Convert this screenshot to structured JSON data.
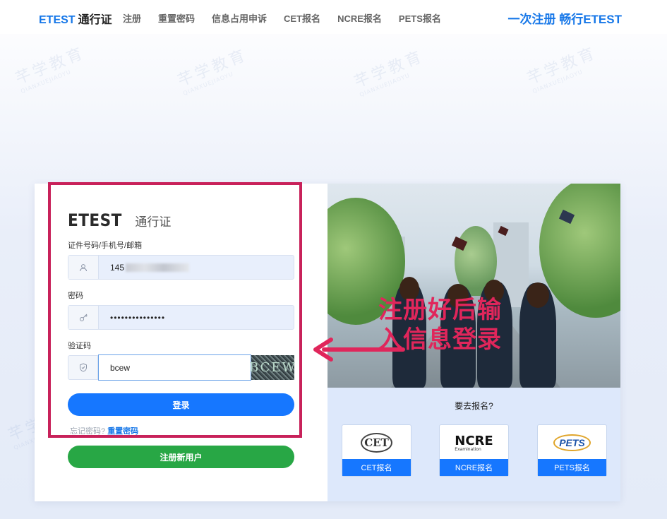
{
  "nav": {
    "brand": "ETEST",
    "brand_sub": "通行证",
    "links": [
      "注册",
      "重置密码",
      "信息占用申诉",
      "CET报名",
      "NCRE报名",
      "PETS报名"
    ],
    "slogan": "一次注册 畅行ETEST"
  },
  "watermark": {
    "text": "芊学教育",
    "sub": "QIANXUEJIAOYU"
  },
  "login": {
    "logo_big": "ETEST",
    "logo_small": "通行证",
    "id_label": "证件号码/手机号/邮箱",
    "id_value": "145",
    "password_label": "密码",
    "password_value": "•••••••••••••••",
    "captcha_label": "验证码",
    "captcha_value": "bcew",
    "captcha_image_text": "BCEW",
    "login_button": "登录",
    "forgot_text": "忘记密码?",
    "reset_link": "重置密码",
    "register_button": "注册新用户"
  },
  "annotation": {
    "text": "注册好后输入信息登录",
    "color": "#e0265b"
  },
  "goto": {
    "title": "要去报名?",
    "cards": [
      {
        "logo": "CET",
        "label": "CET报名"
      },
      {
        "logo": "NCRE",
        "logo_sub": "Examination",
        "label": "NCRE报名"
      },
      {
        "logo": "PETS",
        "label": "PETS报名"
      }
    ]
  },
  "colors": {
    "primary": "#1677ff",
    "green": "#28a745",
    "highlight": "#c8215a"
  }
}
